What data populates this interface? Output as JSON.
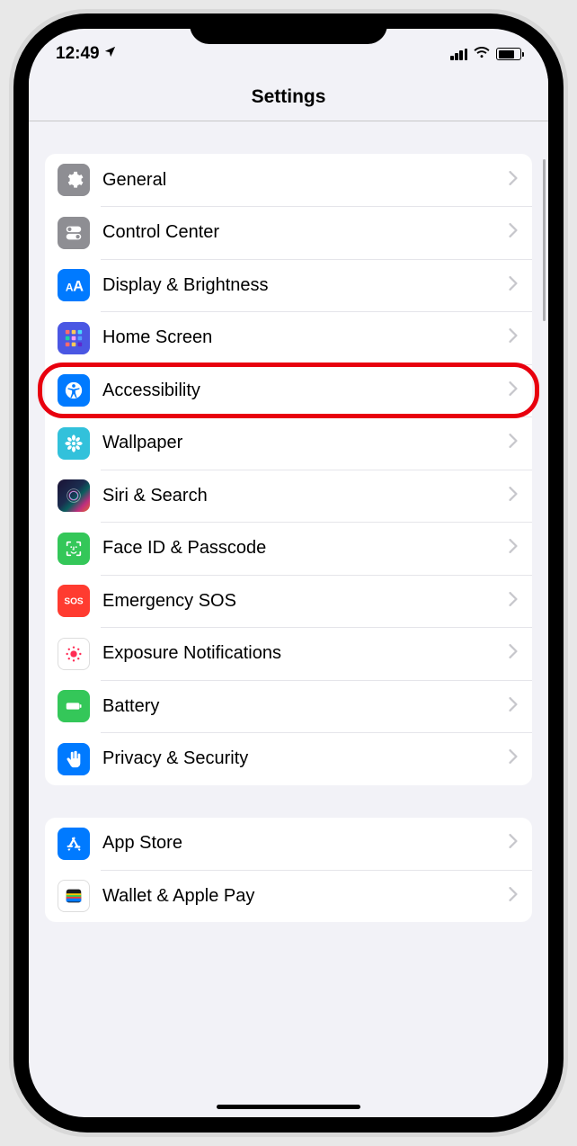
{
  "status": {
    "time": "12:49"
  },
  "header": {
    "title": "Settings"
  },
  "groups": [
    {
      "items": [
        {
          "icon": "gear",
          "bg": "bg-gray",
          "label": "General"
        },
        {
          "icon": "toggles",
          "bg": "bg-gray",
          "label": "Control Center"
        },
        {
          "icon": "aa",
          "bg": "bg-blue",
          "label": "Display & Brightness"
        },
        {
          "icon": "grid",
          "bg": "bg-indigo",
          "label": "Home Screen"
        },
        {
          "icon": "accessibility",
          "bg": "bg-blue",
          "label": "Accessibility",
          "highlighted": true
        },
        {
          "icon": "flower",
          "bg": "bg-cyan",
          "label": "Wallpaper"
        },
        {
          "icon": "siri",
          "bg": "bg-siri",
          "label": "Siri & Search"
        },
        {
          "icon": "faceid",
          "bg": "bg-green",
          "label": "Face ID & Passcode"
        },
        {
          "icon": "sos",
          "bg": "bg-red",
          "label": "Emergency SOS"
        },
        {
          "icon": "exposure",
          "bg": "bg-white",
          "label": "Exposure Notifications"
        },
        {
          "icon": "battery",
          "bg": "bg-green",
          "label": "Battery"
        },
        {
          "icon": "hand",
          "bg": "bg-blue",
          "label": "Privacy & Security"
        }
      ]
    },
    {
      "items": [
        {
          "icon": "appstore",
          "bg": "bg-blue",
          "label": "App Store"
        },
        {
          "icon": "wallet",
          "bg": "bg-white",
          "label": "Wallet & Apple Pay"
        }
      ]
    }
  ]
}
